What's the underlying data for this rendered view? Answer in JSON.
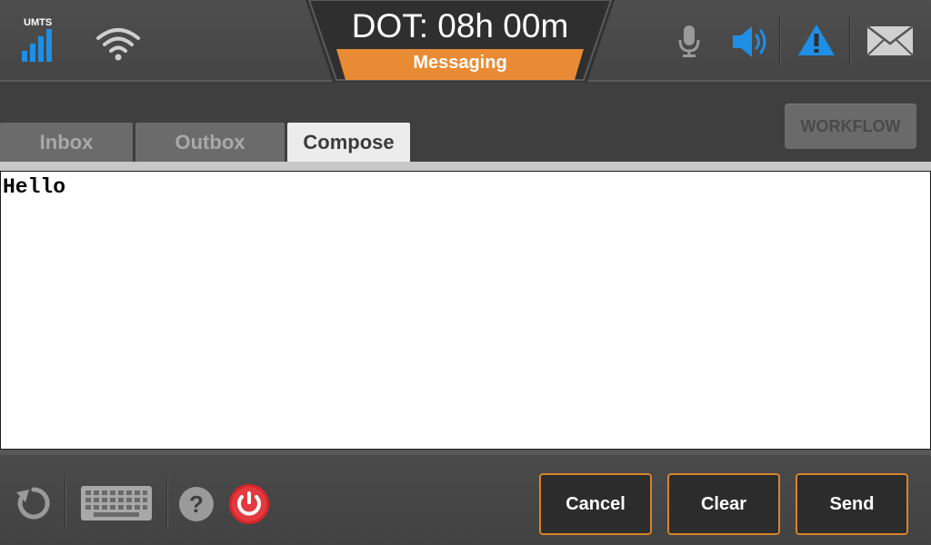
{
  "status": {
    "network_label": "UMTS",
    "dot_label": "DOT: 08h 00m",
    "mode_label": "Messaging"
  },
  "tabs": [
    {
      "label": "Inbox",
      "active": false
    },
    {
      "label": "Outbox",
      "active": false
    },
    {
      "label": "Compose",
      "active": true
    }
  ],
  "workflow_label": "WORKFLOW",
  "compose": {
    "body": "Hello"
  },
  "buttons": {
    "cancel": "Cancel",
    "clear": "Clear",
    "send": "Send"
  },
  "colors": {
    "accent": "#e98b35",
    "signal_blue": "#1e8fe6",
    "power_red": "#d9262b"
  },
  "icons": [
    "signal-bars-icon",
    "wifi-icon",
    "microphone-icon",
    "speaker-icon",
    "warning-icon",
    "mail-icon",
    "refresh-icon",
    "keyboard-icon",
    "help-icon",
    "power-icon"
  ]
}
